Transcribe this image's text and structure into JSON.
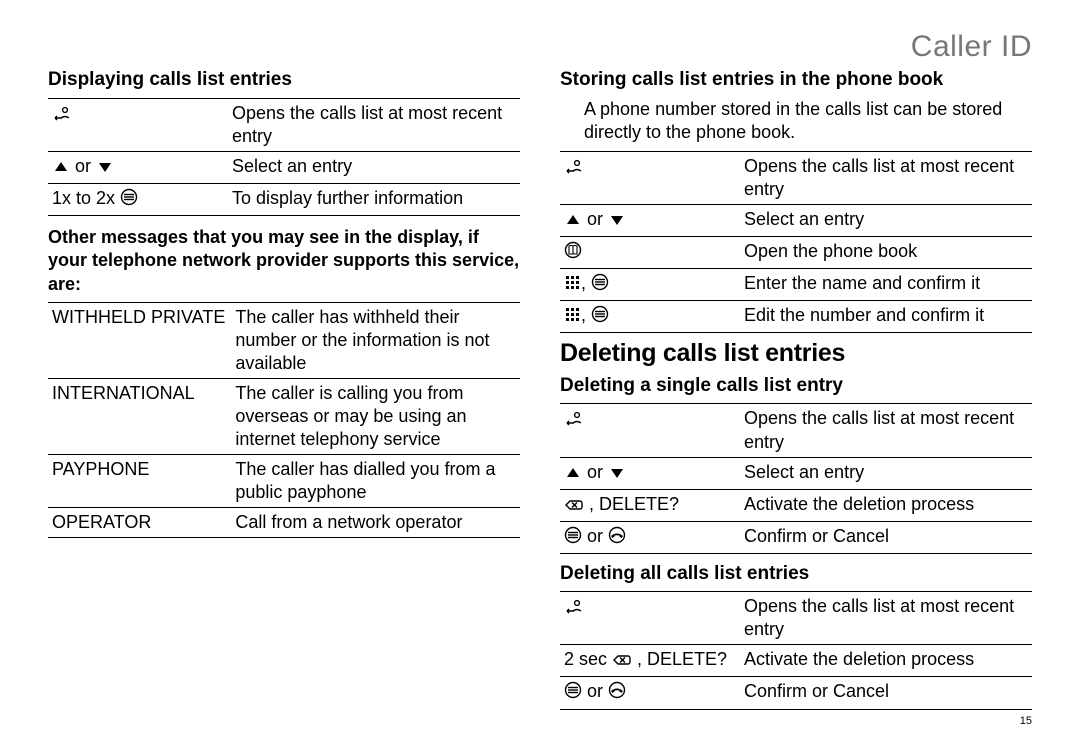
{
  "header": {
    "title": "Caller ID"
  },
  "page_number": "15",
  "left": {
    "h1": "Displaying calls list entries",
    "t1": {
      "r0d": "Opens the calls list at most recent entry",
      "r1k_or": " or ",
      "r1d": "Select an entry",
      "r2k": "1x to 2x ",
      "r2d": "To display further information"
    },
    "note": "Other messages that you may see in the display, if your telephone network provider supports this service, are:",
    "t2": {
      "r0k": "WITHHELD PRIVATE",
      "r0d": "The caller has withheld their number or the information is not available",
      "r1k": "INTERNATIONAL",
      "r1d": "The caller is calling you from overseas or may be using an internet telephony service",
      "r2k": "PAYPHONE",
      "r2d": "The caller has dialled you from a public payphone",
      "r3k": "OPERATOR",
      "r3d": "Call from a network operator"
    }
  },
  "right": {
    "h1": "Storing calls list entries in the phone book",
    "p1": "A phone number stored in the calls list can be stored directly to the phone book.",
    "t1": {
      "r0d": "Opens the calls list at most recent entry",
      "r1k_or": " or ",
      "r1d": "Select an entry",
      "r2d": "Open the phone book",
      "r3d": "Enter the name and confirm it",
      "r4d": "Edit the number and confirm it"
    },
    "h2": "Deleting calls list entries",
    "h3": "Deleting a single calls list entry",
    "t2": {
      "r0d": "Opens the calls list at most recent entry",
      "r1k_or": " or ",
      "r1d": "Select an entry",
      "r2k_tail": " , DELETE?",
      "r2d": "Activate the deletion process",
      "r3k_or": "  or  ",
      "r3d": "Confirm or Cancel"
    },
    "h4": "Deleting all calls list entries",
    "t3": {
      "r0d": "Opens the calls list at most recent entry",
      "r1k_pre": "2 sec ",
      "r1k_tail": " , DELETE?",
      "r1d": "Activate the deletion process",
      "r2k_or": "  or  ",
      "r2d": "Confirm or Cancel"
    }
  }
}
